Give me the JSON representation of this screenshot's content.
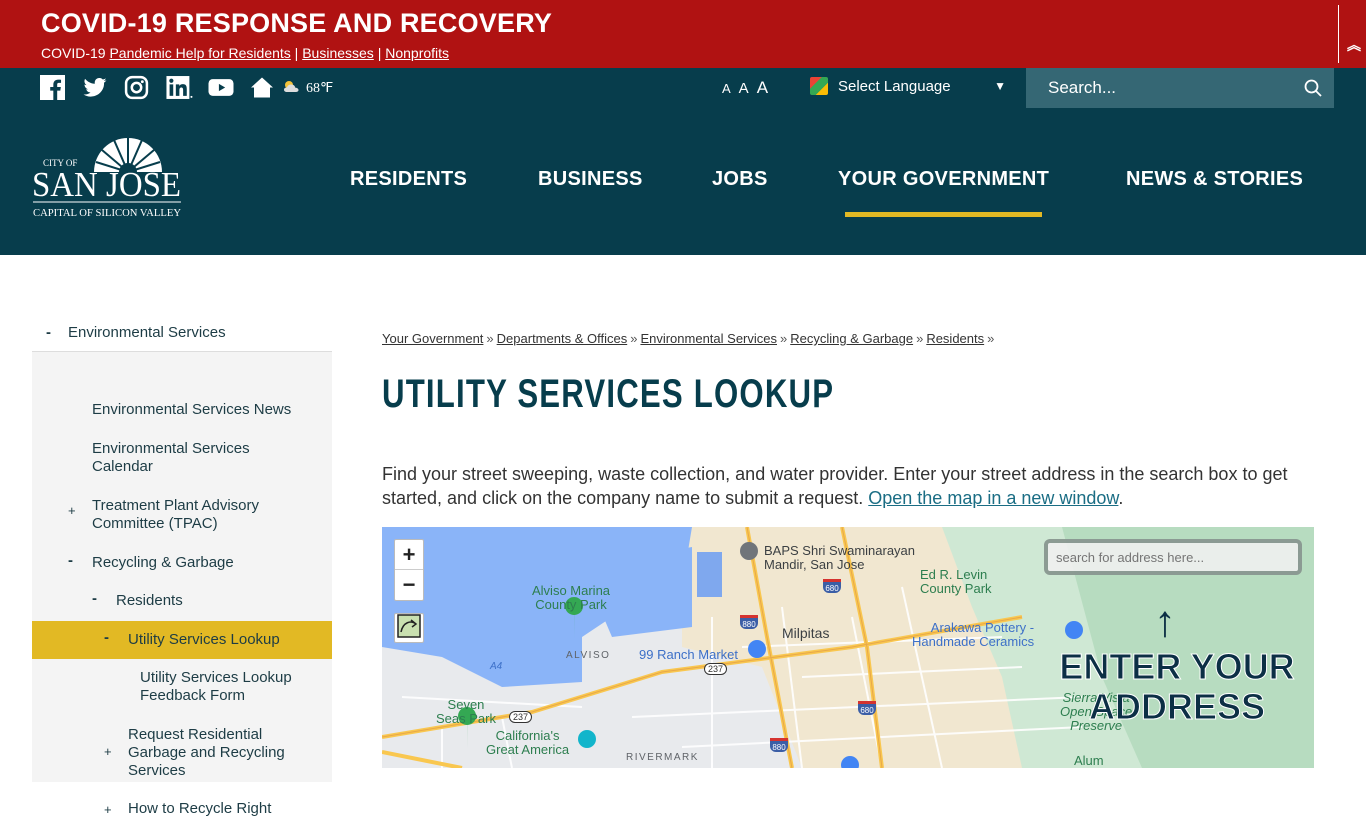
{
  "covid": {
    "title": "COVID-19 RESPONSE AND RECOVERY",
    "prefix": "COVID-19",
    "links": [
      "Pandemic Help for Residents",
      "Businesses",
      "Nonprofits"
    ],
    "separator": "|",
    "toggle_icon": "double-chevron-up"
  },
  "utility": {
    "social": [
      "facebook",
      "twitter",
      "instagram",
      "linkedin",
      "youtube",
      "home"
    ],
    "weather": {
      "icon": "partly-cloudy",
      "temp": "68℉"
    },
    "font_sizes": [
      "A",
      "A",
      "A"
    ],
    "language": "Select Language",
    "search_placeholder": "Search..."
  },
  "header": {
    "logo": {
      "city_of": "CITY OF",
      "name": "SAN JOSE",
      "tagline": "CAPITAL OF SILICON VALLEY"
    },
    "nav": [
      "RESIDENTS",
      "BUSINESS",
      "JOBS",
      "YOUR GOVERNMENT",
      "NEWS & STORIES"
    ],
    "active_nav": "YOUR GOVERNMENT"
  },
  "sidebar": {
    "top": {
      "sign": "-",
      "label": "Environmental Services"
    },
    "items": [
      {
        "sign": "",
        "label": "Environmental Services News"
      },
      {
        "sign": "",
        "label": "Environmental Services Calendar"
      },
      {
        "sign": "+",
        "label": "Treatment Plant Advisory Committee (TPAC)"
      },
      {
        "sign": "-",
        "label": "Recycling & Garbage"
      },
      {
        "sign": "-",
        "label": "Residents"
      },
      {
        "sign": "-",
        "label": "Utility Services Lookup",
        "active": true
      },
      {
        "sign": "",
        "label": "Utility Services Lookup Feedback Form"
      },
      {
        "sign": "+",
        "label": "Request Residential Garbage and Recycling Services"
      },
      {
        "sign": "+",
        "label": "How to Recycle Right"
      }
    ]
  },
  "breadcrumb": [
    "Your Government",
    "Departments & Offices",
    "Environmental Services",
    "Recycling & Garbage",
    "Residents"
  ],
  "breadcrumb_sep": "»",
  "page_title": "UTILITY SERVICES LOOKUP",
  "intro": {
    "text": "Find your street sweeping, waste collection, and water provider. Enter your street address in the search box to get started, and click on the company name to submit a request. ",
    "link": "Open the map in a new window",
    "suffix": "."
  },
  "map": {
    "zoom_in": "+",
    "zoom_out": "−",
    "address_placeholder": "search for address here...",
    "overlay_line1": "ENTER YOUR",
    "overlay_line2": "ADDRESS",
    "labels": {
      "alviso_park": "Alviso Marina\nCounty Park",
      "alviso": "ALVISO",
      "baps": "BAPS Shri Swaminarayan\nMandir, San Jose",
      "milpitas": "Milpitas",
      "ranch": "99 Ranch Market",
      "ed_levin": "Ed R. Levin\nCounty Park",
      "arakawa": "Arakawa Pottery -\nHandmade Ceramics",
      "seven_seas": "Seven\nSeas Park",
      "great_america": "California's\nGreat America",
      "rivermark": "RIVERMARK",
      "sierra": "Sierra Vista\nOpen Space\nPreserve",
      "alum": "Alum",
      "a4": "A4"
    },
    "highways": [
      "880",
      "680",
      "237"
    ]
  }
}
